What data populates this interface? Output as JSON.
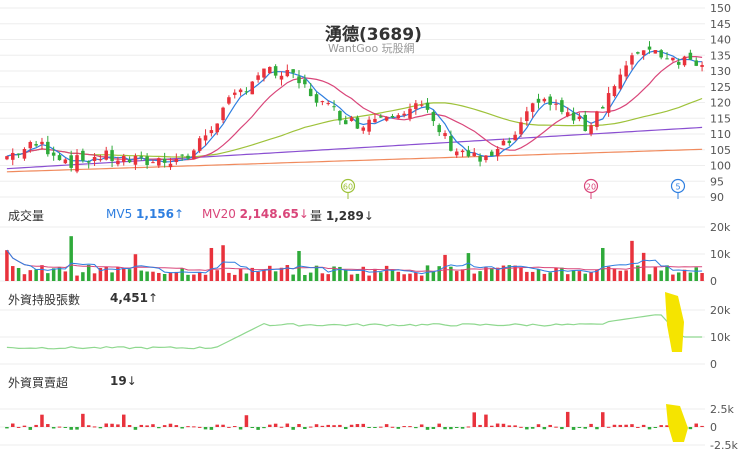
{
  "header": {
    "title": "湧德(3689)",
    "subtitle": "WantGoo 玩股網"
  },
  "volume_panel": {
    "label": "成交量",
    "mv5_label": "MV5",
    "mv5_value": "1,156",
    "mv5_arrow": "↑",
    "mv20_label": "MV20",
    "mv20_value": "2,148.65",
    "mv20_arrow": "↓",
    "vol_label": "量",
    "vol_value": "1,289",
    "vol_arrow": "↓"
  },
  "holdings_panel": {
    "label": "外資持股張數",
    "value": "4,451",
    "arrow": "↑"
  },
  "netbuy_panel": {
    "label": "外資買賣超",
    "value": "19",
    "arrow": "↓"
  },
  "markers": [
    "60",
    "20",
    "5"
  ],
  "colors": {
    "up": "#e8323c",
    "down": "#2faa3a",
    "ma5": "#2f7fe0",
    "ma20": "#d9467a",
    "ma60": "#9ec23a",
    "ma120": "#8a4fd1",
    "ma240": "#f08a5d",
    "holdings": "#8fd88f",
    "highlight": "#f5e400"
  },
  "chart_data": [
    {
      "type": "candlestick",
      "title": "湧德(3689)",
      "ylim": [
        90,
        150
      ],
      "yticks": [
        "150",
        "145",
        "140",
        "135",
        "130",
        "125",
        "120",
        "115",
        "110",
        "105",
        "100",
        "95",
        "90"
      ],
      "series": []
    },
    {
      "type": "bar",
      "title": "成交量",
      "ylim": [
        0,
        20000
      ],
      "yticks": [
        "20k",
        "10k",
        "0"
      ],
      "series": [
        {
          "name": "MV5",
          "value": 1156
        },
        {
          "name": "MV20",
          "value": 2148.65
        },
        {
          "name": "量",
          "value": 1289
        }
      ]
    },
    {
      "type": "line",
      "title": "外資持股張數",
      "ylim": [
        0,
        20000
      ],
      "yticks": [
        "20k",
        "10k",
        "0"
      ],
      "series": [
        {
          "name": "外資持股張數",
          "last": 4451
        }
      ]
    },
    {
      "type": "bar",
      "title": "外資買賣超",
      "ylim": [
        -2500,
        2500
      ],
      "yticks": [
        "2.5k",
        "0",
        "-2.5k"
      ],
      "series": [
        {
          "name": "外資買賣超",
          "last": 19
        }
      ]
    }
  ]
}
